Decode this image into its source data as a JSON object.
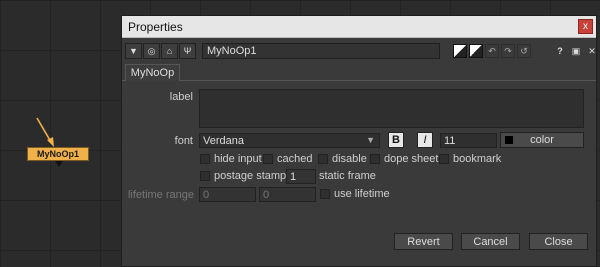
{
  "graph": {
    "node_label": "MyNoOp1",
    "node_color": "#f0b04a"
  },
  "window": {
    "title": "Properties",
    "close_label": "x"
  },
  "toolbar": {
    "node_name": "MyNoOp1",
    "help_label": "?"
  },
  "tabs": [
    {
      "label": "MyNoOp"
    }
  ],
  "form": {
    "label_label": "label",
    "label_value": "",
    "font_label": "font",
    "font_value": "Verdana",
    "bold_label": "B",
    "italic_label": "I",
    "font_size": "11",
    "color_label": "color",
    "checkboxes": {
      "hide_input": "hide input",
      "cached": "cached",
      "disable": "disable",
      "dope_sheet": "dope sheet",
      "bookmark": "bookmark",
      "postage_stamp": "postage stamp"
    },
    "static_frame_value": "1",
    "static_frame_label": "static frame",
    "lifetime_range_label": "lifetime range",
    "lifetime_start": "0",
    "lifetime_end": "0",
    "use_lifetime_label": "use lifetime"
  },
  "footer": {
    "revert": "Revert",
    "cancel": "Cancel",
    "close": "Close"
  }
}
